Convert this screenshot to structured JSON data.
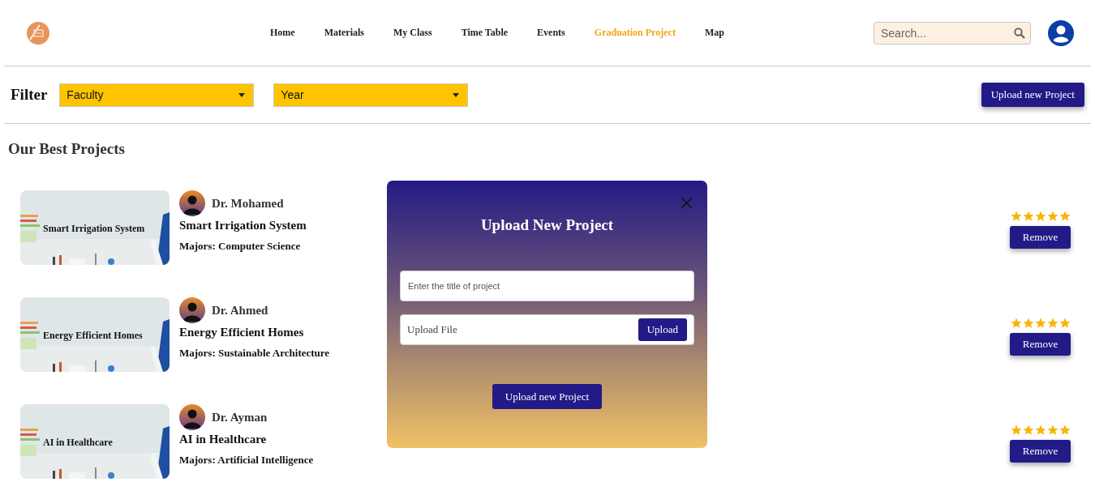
{
  "nav": {
    "items": [
      {
        "label": "Home",
        "selected": false
      },
      {
        "label": "Materials",
        "selected": false
      },
      {
        "label": "My Class",
        "selected": false
      },
      {
        "label": "Time Table",
        "selected": false
      },
      {
        "label": "Events",
        "selected": false
      },
      {
        "label": "Graduation Project",
        "selected": true
      },
      {
        "label": "Map",
        "selected": false
      }
    ],
    "search": {
      "placeholder": "Search..."
    }
  },
  "filter": {
    "label": "Filter",
    "selects": [
      {
        "value": "Faculty"
      },
      {
        "value": "Year"
      }
    ],
    "upload_button": "Upload new Project"
  },
  "section_title": "Our Best Projects",
  "projects": [
    {
      "image_caption": "Smart Irrigation System",
      "author": "Dr. Mohamed",
      "title": "Smart Irrigation System",
      "majors": "Majors: Computer Science",
      "stars": 5,
      "remove": "Remove"
    },
    {
      "image_caption": "Energy Efficient Homes",
      "author": "Dr. Ahmed",
      "title": "Energy Efficient Homes",
      "majors": "Majors: Sustainable Architecture",
      "stars": 5,
      "remove": "Remove"
    },
    {
      "image_caption": "AI in Healthcare",
      "author": "Dr. Ayman",
      "title": "AI in Healthcare",
      "majors": "Majors: Artificial Intelligence",
      "stars": 5,
      "remove": "Remove"
    }
  ],
  "modal": {
    "title": "Upload New Project",
    "title_placeholder": "Enter the title of project",
    "file_label": "Upload File",
    "file_button": "Upload",
    "submit": "Upload new Project"
  }
}
